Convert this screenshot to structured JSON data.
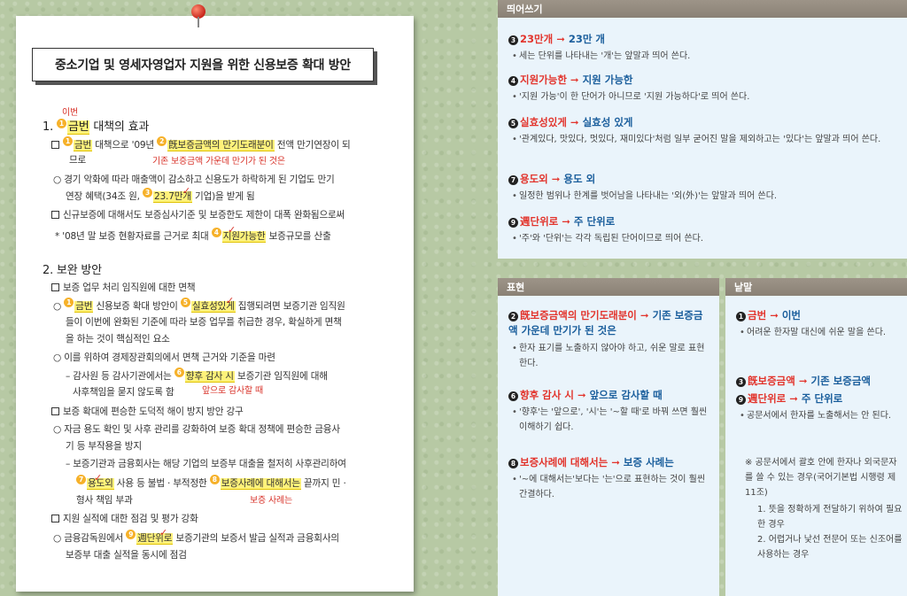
{
  "document": {
    "title": "중소기업 및 영세자영업자 지원을 위한 신용보증 확대 방안",
    "lines": {
      "s1_annot": "이번",
      "s1": "1. ",
      "s1_hl": "금번",
      "s1_rest": " 대책의 효과",
      "l1_a": "금번",
      "l1_b": " 대책으로 '09년 ",
      "l1_hl": "旣보증금액의 만기도래분이",
      "l1_c": " 전액 만기연장이 되",
      "l1_note": "기존 보증금액 가운데 만기가 된 것은",
      "l2": "므로",
      "l3": "○ 경기 악화에 따라 매출액이 감소하고 신용도가 하락하게 된 기업도 만기",
      "l4_a": "연장 혜택(34조 원, ",
      "l4_hl": "23.7만개",
      "l4_b": " 기업)을 받게 됨",
      "l5": "신규보증에 대해서도 보증심사기준 및 보증한도 제한이 대폭 완화됨으로써",
      "l6_a": "* '08년 말 보증 현황자료를 근거로 최대 ",
      "l6_hl": "지원가능한",
      "l6_b": " 보증규모를 산출",
      "s2": "2. 보완 방안",
      "l7": "보증 업무 처리 임직원에 대한 면책",
      "l8_a": "○ ",
      "l8_hl1": "금번",
      "l8_b": " 신용보증 확대 방안이 ",
      "l8_hl2": "실효성있게",
      "l8_c": " 집행되려면 보증기관 임직원",
      "l9": "들이 이번에 완화된 기준에 따라 보증 업무를 취급한 경우, 확실하게 면책",
      "l10": "을 하는 것이 핵심적인 요소",
      "l11": "○ 이를 위하여 경제장관회의에서 면책 근거와 기준을 마련",
      "l12_a": "– 감사원 등 감사기관에서는 ",
      "l12_hl": "향후 감사 시",
      "l12_b": " 보증기관 임직원에 대해",
      "l12_note": "앞으로 감사할 때",
      "l13": "사후책임을 묻지 않도록 함",
      "l14": "보증 확대에 편승한 도덕적 해이 방지 방안 강구",
      "l15": "○ 자금 용도 확인 및 사후 관리를 강화하여 보증 확대 정책에 편승한 금융사",
      "l16": "기 등 부작용을 방지",
      "l17": "– 보증기관과 금융회사는 해당 기업의 보증부 대출을 철저히 사후관리하여",
      "l18_hl1": "용도외",
      "l18_a": " 사용 등 불법 · 부적정한 ",
      "l18_hl2": "보증사례에 대해서는",
      "l18_b": " 끝까지 민 ·",
      "l18_note": "보증 사례는",
      "l19": "형사 책임 부과",
      "l20": "지원 실적에 대한 점검 및 평가 강화",
      "l21_a": "○ 금융감독원에서 ",
      "l21_hl": "週단위로",
      "l21_b": " 보증기관의 보증서 발급 실적과 금융회사의",
      "l22": "보증부 대출 실적을 동시에 점검"
    }
  },
  "spacing_panel": {
    "heading": "띄어쓰기",
    "items": [
      {
        "num": "3",
        "wrong": "23만개",
        "right": "23만 개",
        "desc": "세는 단위를 나타내는 '개'는 앞말과 띄어 쓴다."
      },
      {
        "num": "4",
        "wrong": "지원가능한",
        "right": "지원 가능한",
        "desc": "'지원 가능'이 한 단어가 아니므로 '지원 가능하다'로 띄어 쓴다."
      },
      {
        "num": "5",
        "wrong": "실효성있게",
        "right": "실효성 있게",
        "desc": "'관계있다, 맛있다, 멋있다, 재미있다'처럼 일부 굳어진 말을 제외하고는 '있다'는 앞말과 띄어 쓴다."
      },
      {
        "num": "7",
        "wrong": "용도외",
        "right": "용도 외",
        "desc": "일정한 범위나 한계를 벗어남을 나타내는 '외(外)'는 앞말과 띄어 쓴다."
      },
      {
        "num": "9",
        "wrong": "週단위로",
        "right": "주 단위로",
        "desc": "'주'와 '단위'는 각각 독립된 단어이므로 띄어 쓴다."
      }
    ]
  },
  "expression_panel": {
    "heading": "표현",
    "items": [
      {
        "num": "2",
        "wrong": "旣보증금액의 만기도래분이",
        "right": "기존 보증금액 가운데 만기가 된 것은",
        "desc": "한자 표기를 노출하지 않아야 하고, 쉬운 말로 표현한다."
      },
      {
        "num": "6",
        "wrong": "향후 감사 시",
        "right": "앞으로 감사할 때",
        "desc": "'향후'는 '앞으로', '시'는 '~할 때'로 바꿔 쓰면 훨씬 이해하기 쉽다."
      },
      {
        "num": "8",
        "wrong": "보증사례에 대해서는",
        "right": "보증 사례는",
        "desc": "'~에 대해서는'보다는 '는'으로 표현하는 것이 훨씬 간결하다."
      }
    ]
  },
  "word_panel": {
    "heading": "낱말",
    "items": [
      {
        "num": "1",
        "wrong": "금번",
        "right": "이번",
        "desc": "어려운 한자말 대신에 쉬운 말을 쓴다."
      },
      {
        "num": "3",
        "wrong": "旣보증금액",
        "right": "기존 보증금액",
        "desc": ""
      },
      {
        "num": "9",
        "wrong": "週단위로",
        "right": "주 단위로",
        "desc": "공문서에서 한자를 노출해서는 안 된다."
      }
    ],
    "note_title": "※ 공문서에서 괄호 안에 한자나 외국문자를 쓸 수 있는 경우(국어기본법 시행령 제11조)",
    "note_items": [
      "1. 뜻을 정확하게 전달하기 위하여 필요한 경우",
      "2. 어렵거나 낯선 전문어 또는 신조어를 사용하는 경우"
    ]
  }
}
